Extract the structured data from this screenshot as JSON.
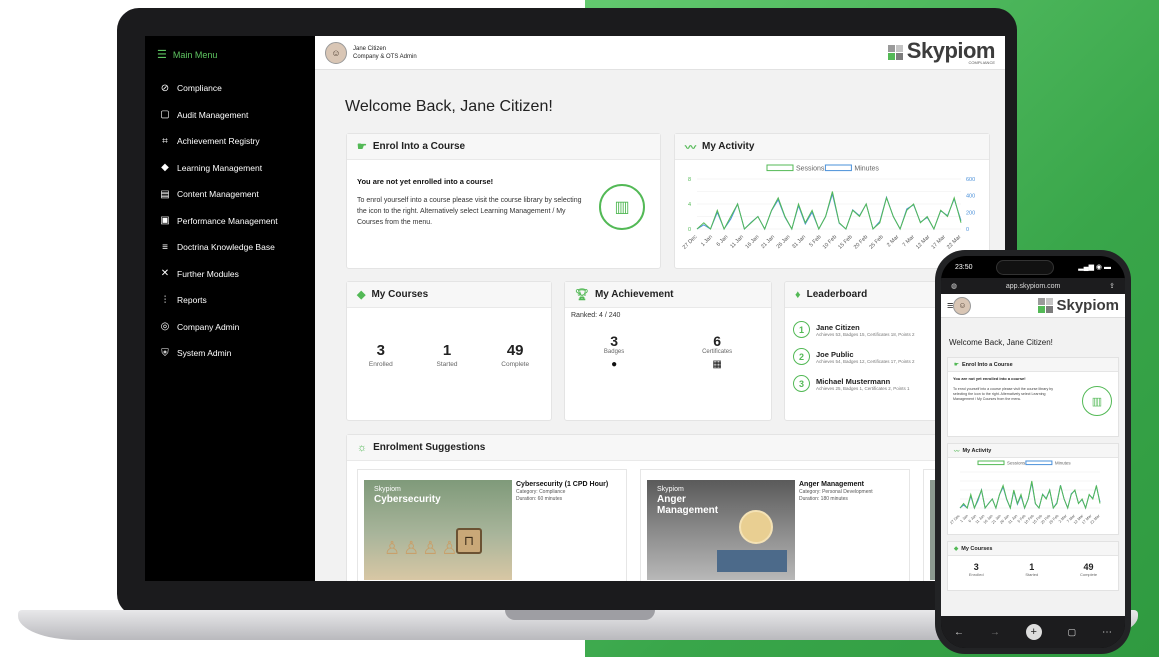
{
  "colors": {
    "brand_green": "#53b956",
    "bg_green": "#3fae4f",
    "sessions_line": "#53b956",
    "minutes_line": "#4a90d9"
  },
  "sidebar": {
    "menu_label": "Main Menu",
    "items": [
      {
        "label": "Compliance",
        "icon": "check-circle-icon"
      },
      {
        "label": "Audit Management",
        "icon": "clipboard-icon"
      },
      {
        "label": "Achievement Registry",
        "icon": "grid-icon"
      },
      {
        "label": "Learning Management",
        "icon": "graduation-cap-icon"
      },
      {
        "label": "Content Management",
        "icon": "content-icon"
      },
      {
        "label": "Performance Management",
        "icon": "calendar-icon"
      },
      {
        "label": "Doctrina Knowledge Base",
        "icon": "database-icon"
      },
      {
        "label": "Further Modules",
        "icon": "tools-icon"
      },
      {
        "label": "Reports",
        "icon": "chart-icon"
      },
      {
        "label": "Company Admin",
        "icon": "company-icon"
      },
      {
        "label": "System Admin",
        "icon": "shield-icon"
      }
    ]
  },
  "header": {
    "user_name": "Jane Citizen",
    "user_role": "Company & OTS Admin",
    "logo_text": "Skypiom",
    "logo_sub": "COMPLIANCE"
  },
  "welcome": "Welcome Back, Jane Citizen!",
  "enrol": {
    "title": "Enrol Into a Course",
    "heading": "You are not yet enrolled into a course!",
    "body": "To enrol yourself into a course please visit the course library by selecting the icon to the right. Alternatively select Learning Management / My Courses from the menu."
  },
  "activity": {
    "title": "My Activity",
    "legend_sessions": "Sessions",
    "legend_minutes": "Minutes"
  },
  "chart_data": {
    "type": "line",
    "title": "My Activity",
    "x": [
      "27 Dec",
      "1 Jan",
      "6 Jan",
      "11 Jan",
      "16 Jan",
      "21 Jan",
      "26 Jan",
      "31 Jan",
      "5 Feb",
      "10 Feb",
      "15 Feb",
      "20 Feb",
      "25 Feb",
      "2 Mar",
      "7 Mar",
      "12 Mar",
      "17 Mar",
      "22 Mar"
    ],
    "y_left_ticks": [
      "0",
      "4",
      "8"
    ],
    "y_right_ticks": [
      "0",
      "200",
      "400",
      "600"
    ],
    "series": [
      {
        "name": "Sessions",
        "values": [
          0,
          1,
          0,
          3,
          0,
          2,
          4,
          0,
          1,
          2,
          0,
          3,
          5,
          2,
          0,
          4,
          1,
          3,
          0,
          2,
          6,
          1,
          0,
          3,
          2,
          4,
          0,
          1,
          5,
          2,
          0,
          3,
          4,
          1,
          2,
          0,
          3,
          2,
          5,
          1
        ]
      },
      {
        "name": "Minutes",
        "values": [
          0,
          50,
          0,
          200,
          0,
          120,
          300,
          0,
          80,
          150,
          0,
          220,
          350,
          140,
          0,
          280,
          60,
          200,
          0,
          150,
          420,
          70,
          0,
          230,
          160,
          300,
          0,
          90,
          380,
          150,
          0,
          240,
          290,
          80,
          140,
          0,
          220,
          160,
          360,
          100
        ]
      }
    ]
  },
  "courses": {
    "title": "My Courses",
    "enrolled": "3",
    "enrolled_label": "Enrolled",
    "started": "1",
    "started_label": "Started",
    "complete": "49",
    "complete_label": "Complete"
  },
  "achievement": {
    "title": "My Achievement",
    "ranked": "Ranked: 4 / 240",
    "badges": "3",
    "badges_label": "Badges",
    "certificates": "6",
    "certificates_label": "Certificates"
  },
  "leaderboard": {
    "title": "Leaderboard",
    "rows": [
      {
        "rank": "1",
        "name": "Jane Citizen",
        "detail": "Achieves 53, Badges 15, Certificates 18, Points 2"
      },
      {
        "rank": "2",
        "name": "Joe Public",
        "detail": "Achieves 54, Badges 12, Certificates 17, Points 2"
      },
      {
        "rank": "3",
        "name": "Michael Mustermann",
        "detail": "Achieves 25, Badges 1, Certificates 2, Points 1"
      }
    ]
  },
  "suggestions": {
    "title": "Enrolment Suggestions",
    "items": [
      {
        "img_brand": "Skypiom",
        "img_title": "Cybersecurity",
        "title": "Cybersecurity (1 CPD Hour)",
        "category": "Category: Compliance",
        "duration": "Duration: 60 minutes"
      },
      {
        "img_brand": "Skypiom",
        "img_title": "Anger Management",
        "title": "Anger Management",
        "category": "Category: Personal Development",
        "duration": "Duration: 180 minutes"
      }
    ]
  },
  "phone": {
    "time": "23:50",
    "url": "app.skypiom.com",
    "welcome": "Welcome Back, Jane Citizen!",
    "enrol_title": "Enrol Into a Course",
    "enrol_heading": "You are not yet enrolled into a course!",
    "enrol_body": "To enrol yourself into a course please visit the course library by selecting the icon to the right. Alternatively select Learning Management / My Courses from the menu.",
    "activity_title": "My Activity",
    "courses_title": "My Courses",
    "enrolled": "3",
    "enrolled_label": "Enrolled",
    "started": "1",
    "started_label": "Started",
    "complete": "49",
    "complete_label": "Complete"
  }
}
